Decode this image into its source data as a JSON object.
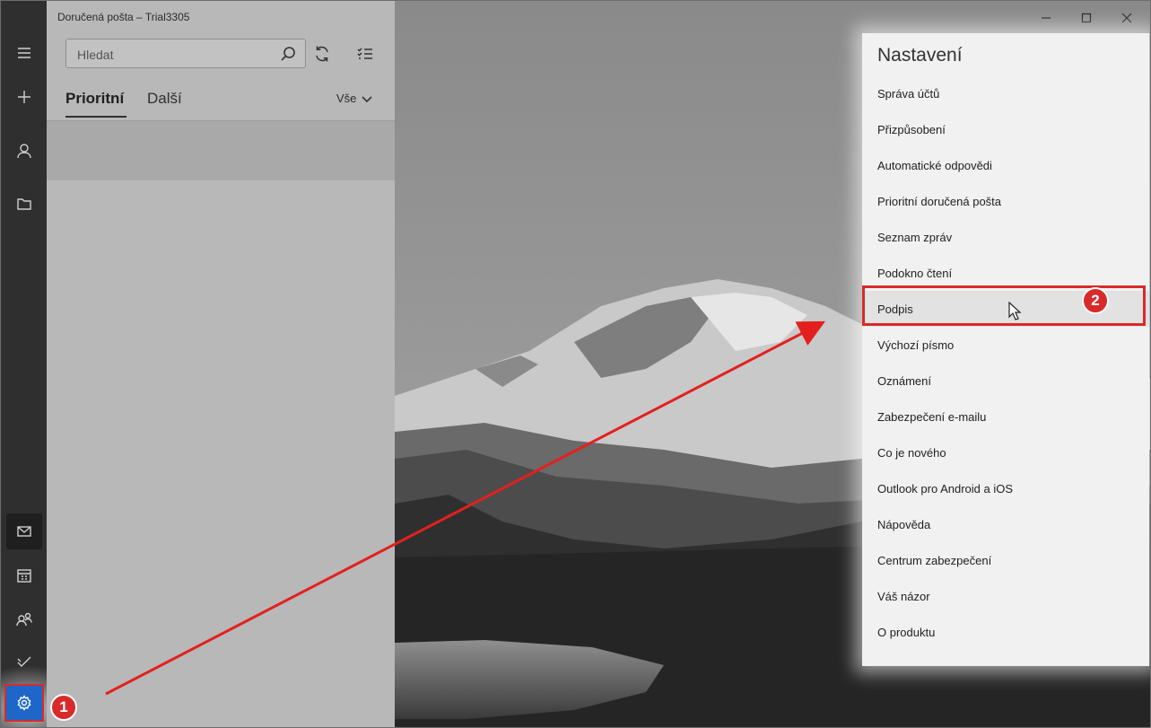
{
  "window": {
    "title": "Doručená pošta – Trial3305",
    "controls": [
      "minimize-icon",
      "maximize-icon",
      "close-icon"
    ]
  },
  "rail": {
    "top_icons": [
      "hamburger-menu-icon",
      "plus-icon",
      "person-icon",
      "folder-icon"
    ],
    "bottom_icons": [
      "mail-icon",
      "calendar-icon",
      "people-icon",
      "todo-check-icon",
      "gear-icon"
    ],
    "active": "mail-icon"
  },
  "search": {
    "placeholder": "Hledat"
  },
  "tabs": [
    {
      "label": "Prioritní",
      "active": true
    },
    {
      "label": "Další",
      "active": false
    }
  ],
  "filter": {
    "label": "Vše"
  },
  "settings": {
    "title": "Nastavení",
    "items": [
      "Správa účtů",
      "Přizpůsobení",
      "Automatické odpovědi",
      "Prioritní doručená pošta",
      "Seznam zpráv",
      "Podokno čtení",
      "Podpis",
      "Výchozí písmo",
      "Oznámení",
      "Zabezpečení e-mailu",
      "Co je nového",
      "Outlook pro Android a iOS",
      "Nápověda",
      "Centrum zabezpečení",
      "Váš názor",
      "O produktu"
    ],
    "highlighted": "Podpis"
  },
  "annotations": {
    "step1": "1",
    "step2": "2",
    "color": "#d92a2a"
  }
}
